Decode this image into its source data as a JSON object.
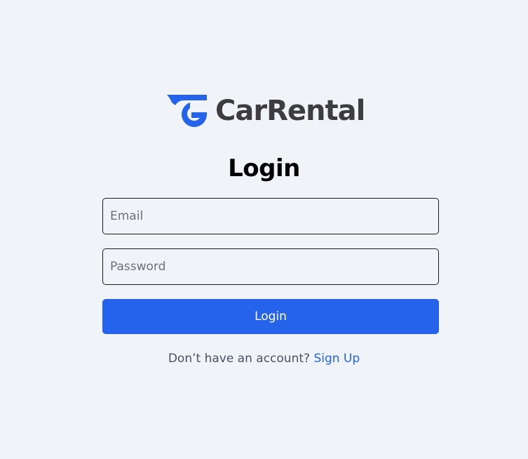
{
  "brand": {
    "name": "CarRental",
    "logo_icon": "carrental-logo-icon",
    "logo_color": "#2563eb",
    "name_color": "#3d3d3f"
  },
  "login": {
    "title": "Login",
    "email_placeholder": "Email",
    "email_value": "",
    "password_placeholder": "Password",
    "password_value": "",
    "submit_label": "Login",
    "submit_color": "#2563eb"
  },
  "signup": {
    "prompt": "Don’t have an account?",
    "link_label": "Sign Up",
    "link_color": "#2563eb"
  },
  "colors": {
    "background": "#f0f4f9"
  }
}
